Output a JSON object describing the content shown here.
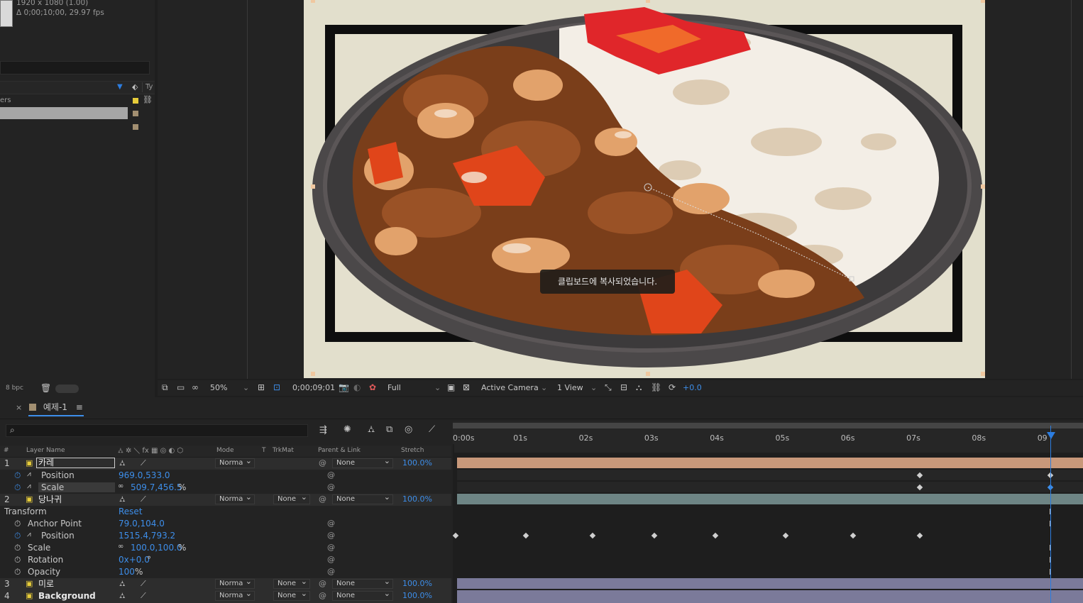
{
  "project": {
    "info_line1": "1920 x 1080 (1.00)",
    "info_line2": "Δ 0;00;10;00, 29.97 fps",
    "column_partial_label": "ers",
    "column_type_partial": "Ty",
    "bpc": "8 bpc"
  },
  "viewer": {
    "toast": "클립보드에 복사되었습니다.",
    "zoom": "50%",
    "timecode": "0;00;09;01",
    "resolution": "Full",
    "camera": "Active Camera",
    "views": "1 View",
    "exposure": "+0.0"
  },
  "timeline": {
    "comp_tab": "예제-1",
    "headers": {
      "num": "#",
      "layer_name": "Layer Name",
      "mode": "Mode",
      "t": "T",
      "trkmat": "TrkMat",
      "parent": "Parent & Link",
      "stretch": "Stretch"
    },
    "ruler_ticks": [
      "0:00s",
      "01s",
      "02s",
      "03s",
      "04s",
      "05s",
      "06s",
      "07s",
      "08s",
      "09"
    ],
    "playhead_seconds": 9.03,
    "layers": [
      {
        "num": "1",
        "name": "카레",
        "mode": "Norma",
        "trkmat": "",
        "parent": "None",
        "stretch": "100.0%",
        "props": [
          {
            "name": "Position",
            "value": "969.0,533.0"
          },
          {
            "name": "Scale",
            "value": "509.7,456.5",
            "unit": "%"
          }
        ]
      },
      {
        "num": "2",
        "name": "당나귀",
        "mode": "Norma",
        "trkmat": "None",
        "parent": "None",
        "stretch": "100.0%",
        "transform_label": "Transform",
        "reset_label": "Reset",
        "props": [
          {
            "name": "Anchor Point",
            "value": "79.0,104.0"
          },
          {
            "name": "Position",
            "value": "1515.4,793.2"
          },
          {
            "name": "Scale",
            "value": "100.0,100.0",
            "unit": "%"
          },
          {
            "name": "Rotation",
            "value": "0x+0.0",
            "unit": "°"
          },
          {
            "name": "Opacity",
            "value": "100",
            "unit": "%"
          }
        ]
      },
      {
        "num": "3",
        "name": "미로",
        "mode": "Norma",
        "trkmat": "None",
        "parent": "None",
        "stretch": "100.0%"
      },
      {
        "num": "4",
        "name": "Background",
        "mode": "Norma",
        "trkmat": "None",
        "parent": "None",
        "stretch": "100.0%"
      }
    ]
  },
  "colors": {
    "accent_blue": "#3d8eea",
    "layer1_bar": "#c8987a",
    "layer2_bar": "#6e8585",
    "layer34_bar": "#7b7a9a",
    "label_yellow": "#e6cc3a",
    "label_tan": "#a28f71"
  }
}
